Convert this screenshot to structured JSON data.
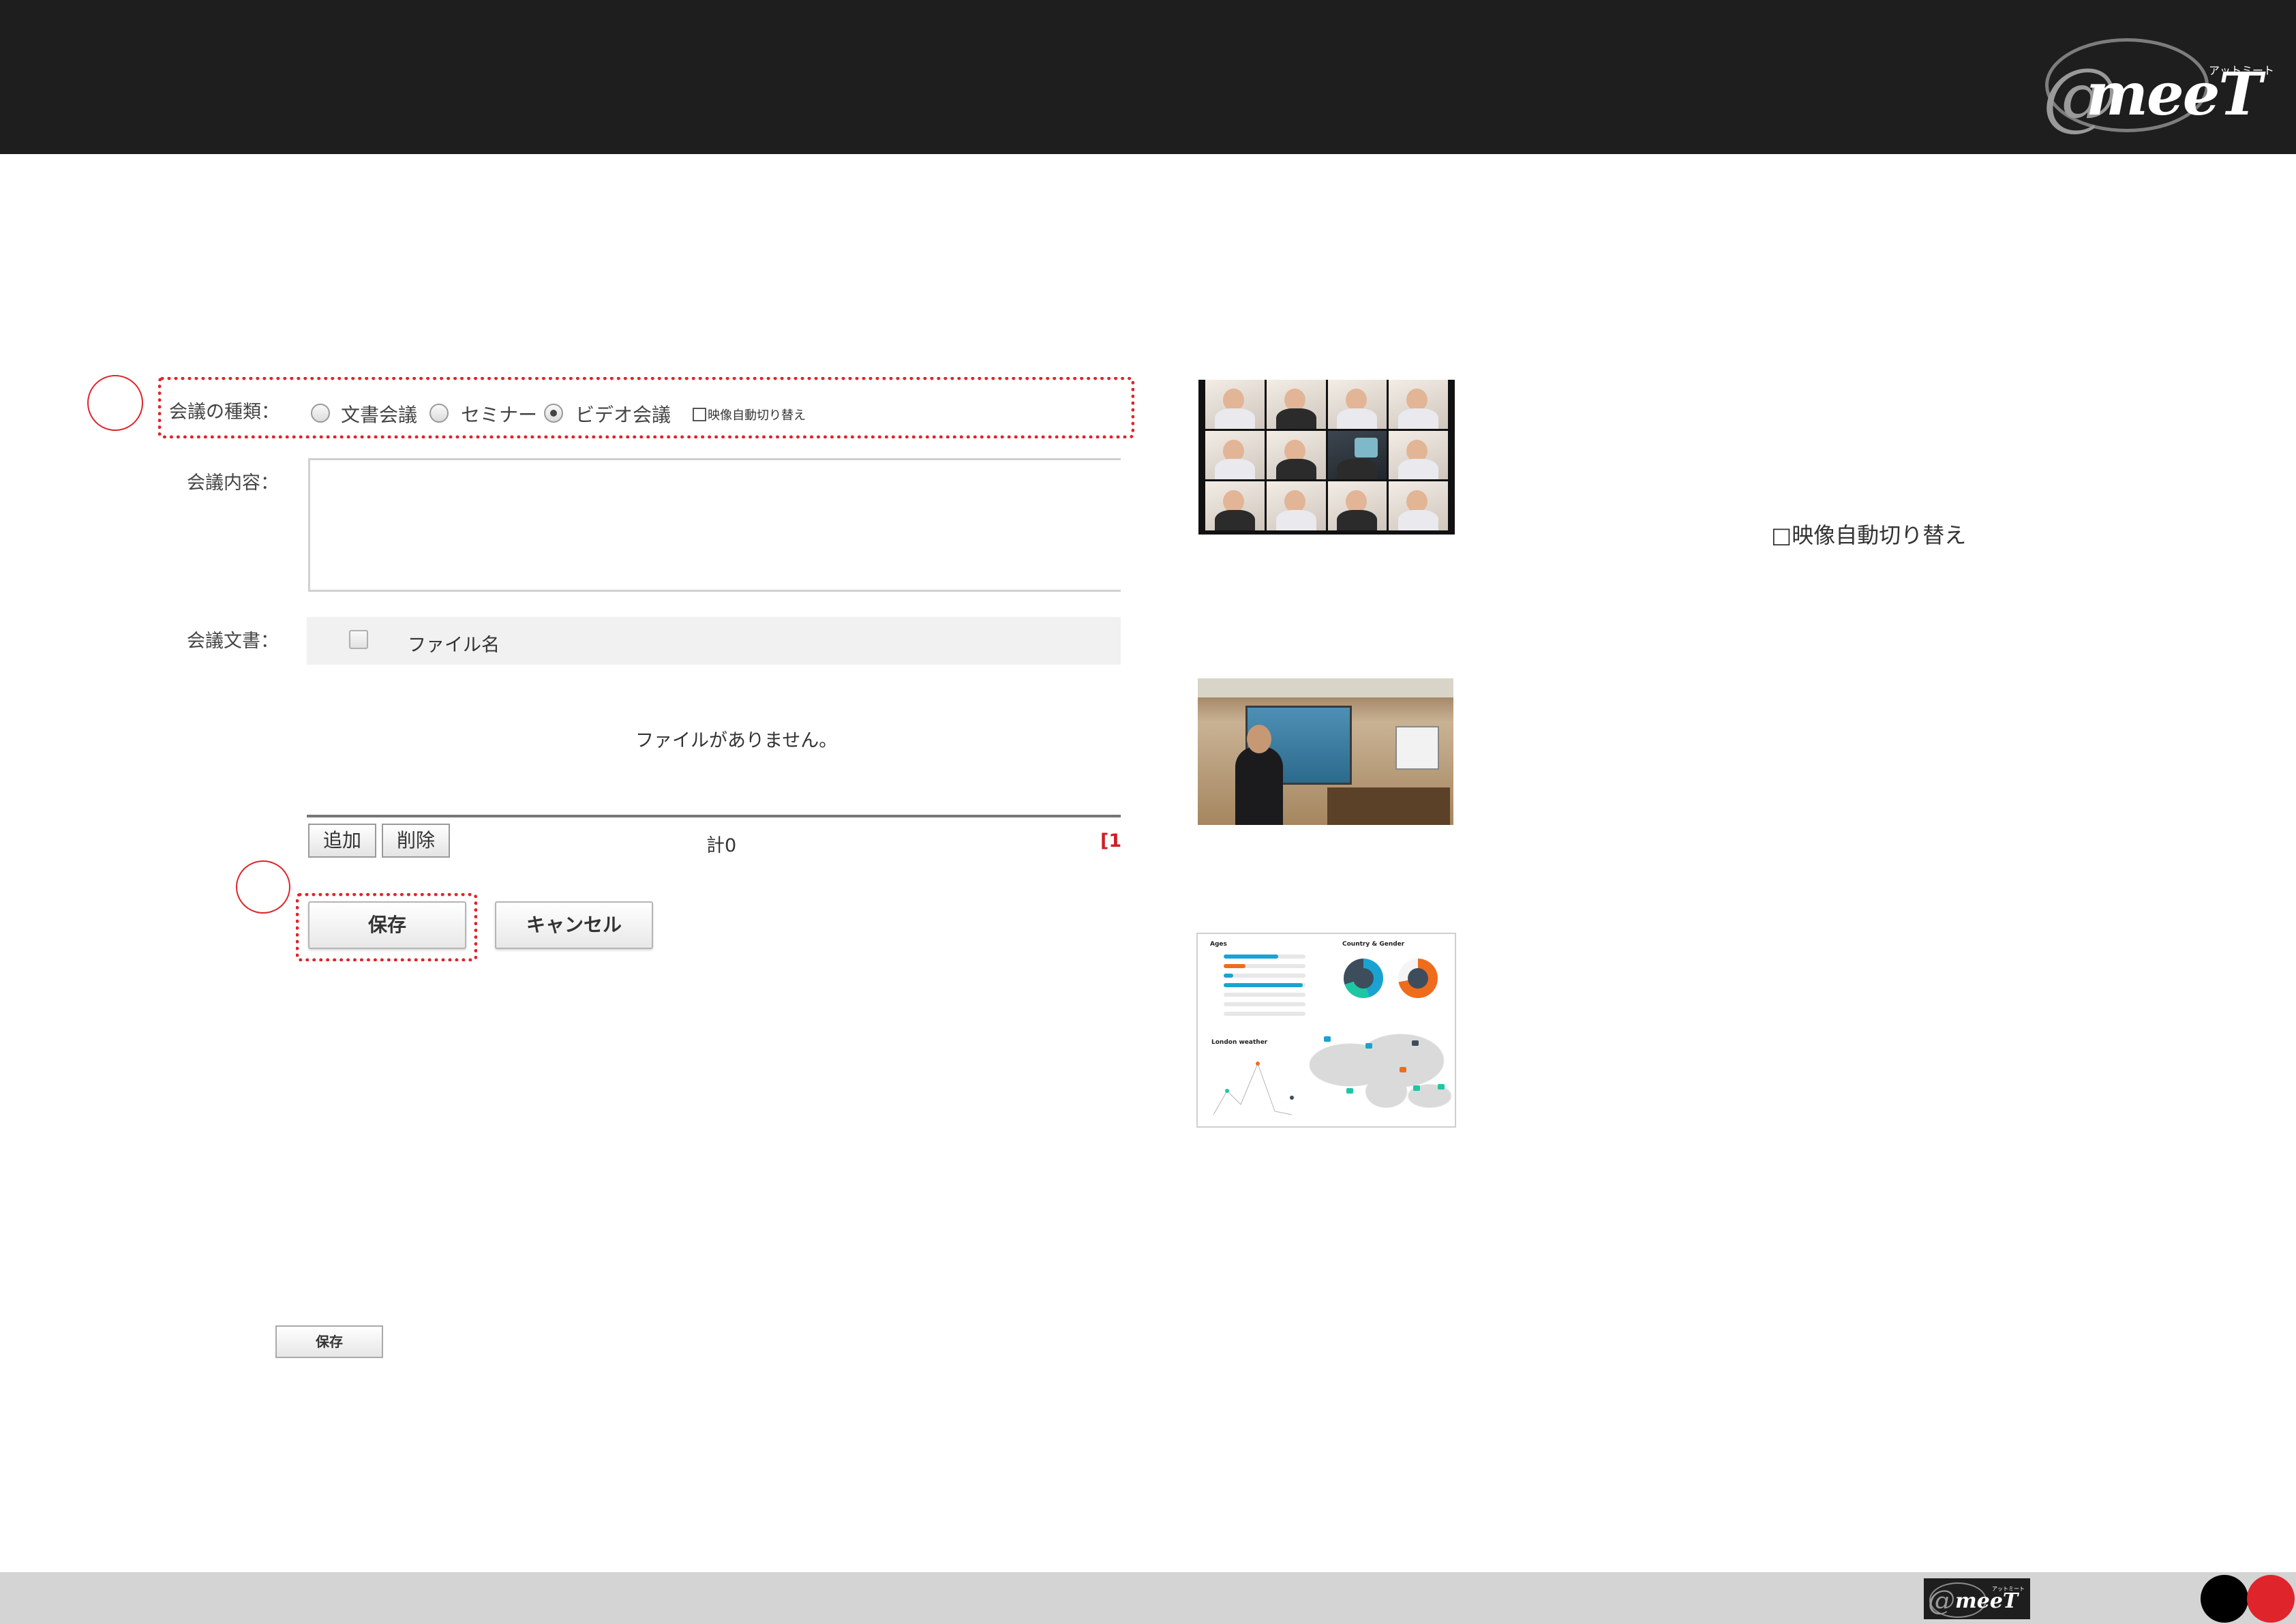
{
  "header": {
    "logo_text": "meeT",
    "logo_at": "@",
    "logo_kana": "アットミート"
  },
  "form": {
    "meeting_type_label": "会議の種類：",
    "radio_options": [
      {
        "label": "文書会議",
        "checked": false
      },
      {
        "label": "セミナー",
        "checked": false
      },
      {
        "label": "ビデオ会議",
        "checked": true
      }
    ],
    "auto_switch_label": "映像自動切り替え",
    "content_label": "会議内容：",
    "documents_label": "会議文書：",
    "file_column_header": "ファイル名",
    "empty_message": "ファイルがありません。",
    "add_button": "追加",
    "delete_button": "削除",
    "total_text": "計0",
    "page_indicator": "[1",
    "save_button": "保存",
    "cancel_button": "キャンセル"
  },
  "side": {
    "auto_switch_large_label": "□映像自動切り替え",
    "mini_save_button": "保存"
  },
  "dashboard_thumb": {
    "ages_title": "Ages",
    "country_gender_title": "Country & Gender",
    "weather_title": "London weather"
  },
  "footer": {
    "logo_text": "meeT",
    "logo_at": "@",
    "logo_kana": "アットミート"
  },
  "colors": {
    "header_bg": "#1e1e1e",
    "footer_bg": "#d4d4d4",
    "accent_red": "#e0242b",
    "footer_dot_black": "#000000"
  }
}
